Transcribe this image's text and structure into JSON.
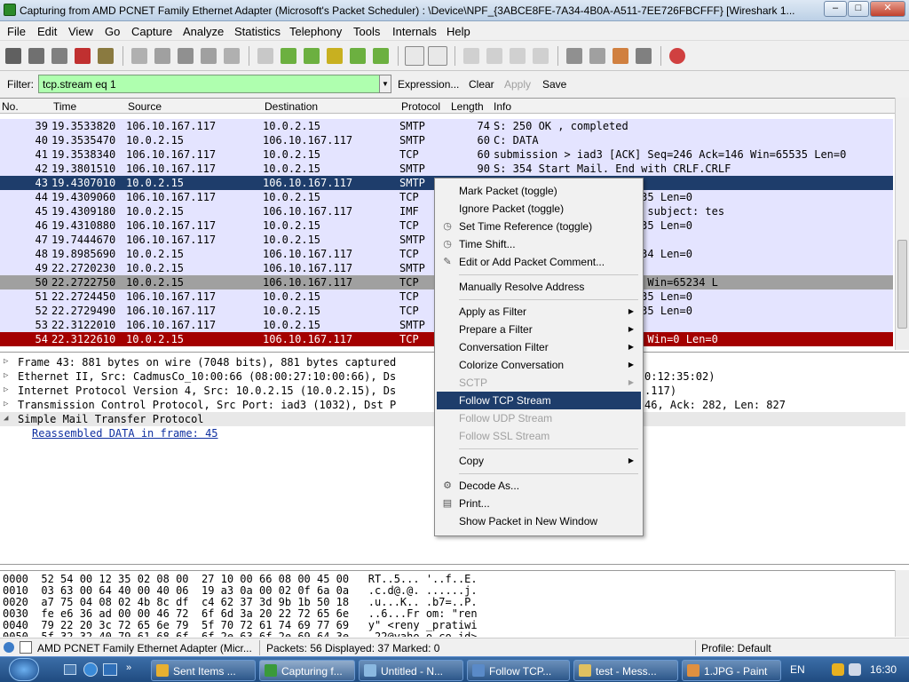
{
  "window": {
    "title": "Capturing from AMD PCNET Family Ethernet Adapter (Microsoft's Packet Scheduler) : \\Device\\NPF_{3ABCE8FE-7A34-4B0A-A511-7EE726FBCFFF}   [Wireshark 1...",
    "min": "–",
    "max": "□",
    "close": "✕"
  },
  "menu": [
    "File",
    "Edit",
    "View",
    "Go",
    "Capture",
    "Analyze",
    "Statistics",
    "Telephony",
    "Tools",
    "Internals",
    "Help"
  ],
  "filter": {
    "label": "Filter:",
    "value": "tcp.stream eq 1",
    "expression": "Expression...",
    "clear": "Clear",
    "apply": "Apply",
    "save": "Save"
  },
  "columns": [
    "No.",
    "Time",
    "Source",
    "Destination",
    "Protocol",
    "Length",
    "Info"
  ],
  "packets": [
    {
      "no": "39",
      "time": "19.3533820",
      "src": "106.10.167.117",
      "dst": "10.0.2.15",
      "proto": "SMTP",
      "len": "74",
      "info": "S: 250 OK , completed",
      "style": "smtp"
    },
    {
      "no": "40",
      "time": "19.3535470",
      "src": "10.0.2.15",
      "dst": "106.10.167.117",
      "proto": "SMTP",
      "len": "60",
      "info": "C: DATA",
      "style": "smtp"
    },
    {
      "no": "41",
      "time": "19.3538340",
      "src": "106.10.167.117",
      "dst": "10.0.2.15",
      "proto": "TCP",
      "len": "60",
      "info": "submission > iad3 [ACK] Seq=246 Ack=146 Win=65535 Len=0",
      "style": "tcp"
    },
    {
      "no": "42",
      "time": "19.3801510",
      "src": "106.10.167.117",
      "dst": "10.0.2.15",
      "proto": "SMTP",
      "len": "90",
      "info": "S: 354 Start Mail. End with CRLF.CRLF",
      "style": "smtp"
    },
    {
      "no": "43",
      "time": "19.4307010",
      "src": "10.0.2.15",
      "dst": "106.10.167.117",
      "proto": "SMTP",
      "len": "",
      "info": "bytes",
      "style": "selected"
    },
    {
      "no": "44",
      "time": "19.4309060",
      "src": "106.10.167.117",
      "dst": "10.0.2.15",
      "proto": "TCP",
      "len": "",
      "info": "Seq=282 Ack=973 Win=65535 Len=0",
      "style": "tcp"
    },
    {
      "no": "45",
      "time": "19.4309180",
      "src": "10.0.2.15",
      "dst": "106.10.167.117",
      "proto": "IMF",
      "len": "",
      "info": "ratiwi_22@yahoo.co.id>, subject: tes",
      "style": "smtp"
    },
    {
      "no": "46",
      "time": "19.4310880",
      "src": "106.10.167.117",
      "dst": "10.0.2.15",
      "proto": "TCP",
      "len": "",
      "info": "Seq=282 Ack=978 Win=65535 Len=0",
      "style": "tcp"
    },
    {
      "no": "47",
      "time": "19.7444670",
      "src": "106.10.167.117",
      "dst": "10.0.2.15",
      "proto": "SMTP",
      "len": "",
      "info": "",
      "style": "smtp"
    },
    {
      "no": "48",
      "time": "19.8985690",
      "src": "10.0.2.15",
      "dst": "106.10.167.117",
      "proto": "TCP",
      "len": "",
      "info": "Seq=978 Ack=302 Win=65234 Len=0",
      "style": "tcp"
    },
    {
      "no": "49",
      "time": "22.2720230",
      "src": "10.0.2.15",
      "dst": "106.10.167.117",
      "proto": "SMTP",
      "len": "",
      "info": "",
      "style": "smtp"
    },
    {
      "no": "50",
      "time": "22.2722750",
      "src": "10.0.2.15",
      "dst": "106.10.167.117",
      "proto": "TCP",
      "len": "",
      "info": "N, ACK] Seq=984 Ack=302 Win=65234 L",
      "style": "fin"
    },
    {
      "no": "51",
      "time": "22.2724450",
      "src": "106.10.167.117",
      "dst": "10.0.2.15",
      "proto": "TCP",
      "len": "",
      "info": "Seq=302 Ack=984 Win=65535 Len=0",
      "style": "tcp"
    },
    {
      "no": "52",
      "time": "22.2729490",
      "src": "106.10.167.117",
      "dst": "10.0.2.15",
      "proto": "TCP",
      "len": "",
      "info": "Seq=302 Ack=985 Win=65535 Len=0",
      "style": "tcp"
    },
    {
      "no": "53",
      "time": "22.3122010",
      "src": "106.10.167.117",
      "dst": "10.0.2.15",
      "proto": "SMTP",
      "len": "",
      "info": "g transmission",
      "style": "smtp"
    },
    {
      "no": "54",
      "time": "22.3122610",
      "src": "10.0.2.15",
      "dst": "106.10.167.117",
      "proto": "TCP",
      "len": "",
      "info": "T, ACK] Seq=985 Ack=336 Win=0 Len=0",
      "style": "rst"
    }
  ],
  "details": [
    {
      "text": "Frame 43: 881 bytes on wire (7048 bits), 881 bytes captured",
      "tail": "",
      "arrow": "▷",
      "link": false
    },
    {
      "text": "Ethernet II, Src: CadmusCo_10:00:66 (08:00:27:10:00:66), Ds",
      "tail": "0:12:35:02)",
      "arrow": "▷",
      "link": false
    },
    {
      "text": "Internet Protocol Version 4, Src: 10.0.2.15 (10.0.2.15), Ds",
      "tail": ".117)",
      "arrow": "▷",
      "link": false
    },
    {
      "text": "Transmission Control Protocol, Src Port: iad3 (1032), Dst P",
      "tail": "46, Ack: 282, Len: 827",
      "arrow": "▷",
      "link": false
    },
    {
      "text": "Simple Mail Transfer Protocol",
      "tail": "",
      "arrow": "◢",
      "link": false
    },
    {
      "text": "Reassembled DATA in frame: 45",
      "tail": "",
      "arrow": "",
      "link": true
    }
  ],
  "hex": [
    "0000  52 54 00 12 35 02 08 00  27 10 00 66 08 00 45 00   RT..5... '..f..E.",
    "0010  03 63 00 64 40 00 40 06  19 a3 0a 00 02 0f 6a 0a   .c.d@.@. ......j.",
    "0020  a7 75 04 08 02 4b 8c df  c4 62 37 3d 9b 1b 50 18   .u...K.. .b7=..P.",
    "0030  fe e6 36 ad 00 00 46 72  6f 6d 3a 20 22 72 65 6e   ..6...Fr om: \"ren",
    "0040  79 22 20 3c 72 65 6e 79  5f 70 72 61 74 69 77 69   y\" <reny _pratiwi",
    "0050  5f 32 32 40 79 61 68 6f  6f 2e 63 6f 2e 69 64 3e   _22@yaho o.co.id>"
  ],
  "context_menu": [
    {
      "label": "Mark Packet (toggle)",
      "icon": "",
      "submenu": false,
      "disabled": false,
      "selected": false
    },
    {
      "label": "Ignore Packet (toggle)",
      "icon": "",
      "submenu": false,
      "disabled": false,
      "selected": false
    },
    {
      "label": "Set Time Reference (toggle)",
      "icon": "clock-icon",
      "submenu": false,
      "disabled": false,
      "selected": false
    },
    {
      "label": "Time Shift...",
      "icon": "clock-icon",
      "submenu": false,
      "disabled": false,
      "selected": false
    },
    {
      "label": "Edit or Add Packet Comment...",
      "icon": "comment-icon",
      "submenu": false,
      "disabled": false,
      "selected": false
    },
    {
      "sep": true
    },
    {
      "label": "Manually Resolve Address",
      "icon": "",
      "submenu": false,
      "disabled": false,
      "selected": false
    },
    {
      "sep": true
    },
    {
      "label": "Apply as Filter",
      "icon": "",
      "submenu": true,
      "disabled": false,
      "selected": false
    },
    {
      "label": "Prepare a Filter",
      "icon": "",
      "submenu": true,
      "disabled": false,
      "selected": false
    },
    {
      "label": "Conversation Filter",
      "icon": "",
      "submenu": true,
      "disabled": false,
      "selected": false
    },
    {
      "label": "Colorize Conversation",
      "icon": "",
      "submenu": true,
      "disabled": false,
      "selected": false
    },
    {
      "label": "SCTP",
      "icon": "",
      "submenu": true,
      "disabled": true,
      "selected": false
    },
    {
      "label": "Follow TCP Stream",
      "icon": "",
      "submenu": false,
      "disabled": false,
      "selected": true
    },
    {
      "label": "Follow UDP Stream",
      "icon": "",
      "submenu": false,
      "disabled": true,
      "selected": false
    },
    {
      "label": "Follow SSL Stream",
      "icon": "",
      "submenu": false,
      "disabled": true,
      "selected": false
    },
    {
      "sep": true
    },
    {
      "label": "Copy",
      "icon": "",
      "submenu": true,
      "disabled": false,
      "selected": false
    },
    {
      "sep": true
    },
    {
      "label": "Decode As...",
      "icon": "decode-icon",
      "submenu": false,
      "disabled": false,
      "selected": false
    },
    {
      "label": "Print...",
      "icon": "print-icon",
      "submenu": false,
      "disabled": false,
      "selected": false
    },
    {
      "label": "Show Packet in New Window",
      "icon": "",
      "submenu": false,
      "disabled": false,
      "selected": false
    }
  ],
  "status": {
    "interface": "AMD PCNET Family Ethernet Adapter (Micr...",
    "packets": "Packets: 56 Displayed: 37 Marked: 0",
    "profile": "Profile: Default"
  },
  "taskbar": {
    "items": [
      "Sent Items ...",
      "Capturing f...",
      "Untitled - N...",
      "Follow TCP...",
      "test - Mess...",
      "1.JPG - Paint"
    ],
    "lang": "EN",
    "clock": "16:30"
  },
  "colors": {
    "smtp_row": "#e4e4ff",
    "tcp_row": "#e4e4ff",
    "selected_row": "#1e3d6b",
    "fin_row": "#a0a0a0",
    "rst_row": "#a40000",
    "filter_ok": "#afffaf"
  }
}
